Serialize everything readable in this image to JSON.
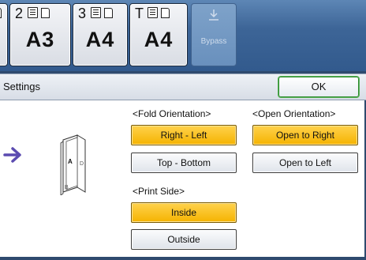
{
  "trays": [
    {
      "number": "",
      "size": "",
      "icons": [
        "doc-icon"
      ]
    },
    {
      "number": "2",
      "size": "A3",
      "icons": [
        "paper-stack-icon",
        "doc-icon"
      ]
    },
    {
      "number": "3",
      "size": "A4",
      "icons": [
        "paper-stack-icon",
        "doc-icon"
      ]
    },
    {
      "number": "T",
      "size": "A4",
      "icons": [
        "paper-stack-icon",
        "doc-icon"
      ]
    }
  ],
  "bypass": {
    "label": "Bypass",
    "icon": "bypass-tray-icon",
    "state": "disabled"
  },
  "settings": {
    "title": "Settings",
    "ok_label": "OK"
  },
  "illustration": {
    "arrow_icon": "arrow-right-icon",
    "book_icon": "folded-booklet-icon",
    "page_labels": [
      "A",
      "D",
      "B"
    ]
  },
  "fold_orientation": {
    "label": "<Fold Orientation>",
    "options": [
      {
        "label": "Right - Left",
        "selected": true
      },
      {
        "label": "Top - Bottom",
        "selected": false
      }
    ]
  },
  "open_orientation": {
    "label": "<Open Orientation>",
    "options": [
      {
        "label": "Open to Right",
        "selected": true
      },
      {
        "label": "Open to Left",
        "selected": false
      }
    ]
  },
  "print_side": {
    "label": "<Print Side>",
    "options": [
      {
        "label": "Inside",
        "selected": true
      },
      {
        "label": "Outside",
        "selected": false
      }
    ]
  },
  "colors": {
    "selected": "#f5b300",
    "ok_border": "#2f8a2f",
    "header_blue": "#3d6597",
    "arrow": "#5b4bb0"
  }
}
